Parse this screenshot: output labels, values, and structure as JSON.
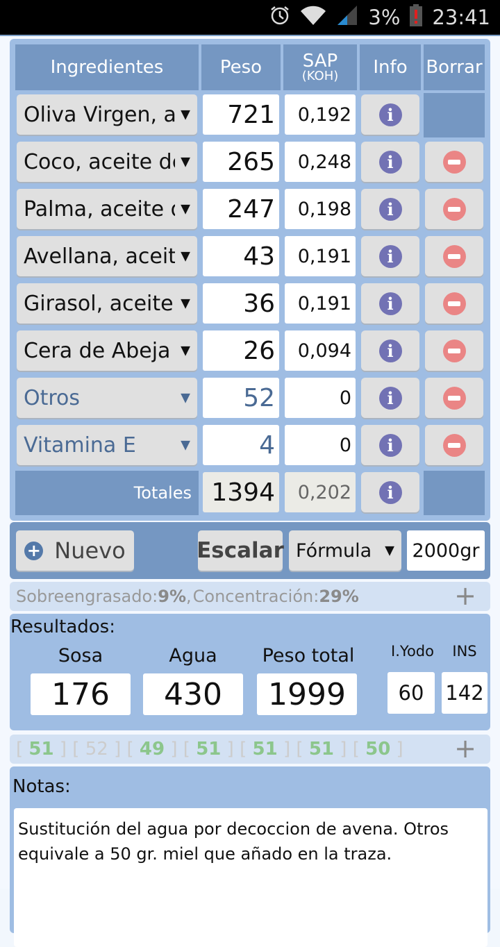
{
  "status_bar": {
    "battery_percent": "3%",
    "time": "23:41",
    "icons": [
      "alarm-icon",
      "wifi-icon",
      "signal-icon",
      "battery-low-icon"
    ]
  },
  "table": {
    "headers": {
      "ingredients": "Ingredientes",
      "weight": "Peso",
      "sap": "SAP",
      "sap_unit": "(KOH)",
      "info": "Info",
      "delete": "Borrar"
    },
    "rows": [
      {
        "ingredient": "Oliva Virgen, aceite de",
        "weight": "721",
        "sap": "0,192",
        "deletable": false,
        "custom": false
      },
      {
        "ingredient": "Coco, aceite de",
        "weight": "265",
        "sap": "0,248",
        "deletable": true,
        "custom": false
      },
      {
        "ingredient": "Palma, aceite de",
        "weight": "247",
        "sap": "0,198",
        "deletable": true,
        "custom": false
      },
      {
        "ingredient": "Avellana, aceite de",
        "weight": "43",
        "sap": "0,191",
        "deletable": true,
        "custom": false
      },
      {
        "ingredient": "Girasol, aceite",
        "weight": "36",
        "sap": "0,191",
        "deletable": true,
        "custom": false
      },
      {
        "ingredient": "Cera de Abeja",
        "weight": "26",
        "sap": "0,094",
        "deletable": true,
        "custom": false
      },
      {
        "ingredient": "Otros",
        "weight": "52",
        "sap": "0",
        "deletable": true,
        "custom": true
      },
      {
        "ingredient": "Vitamina E",
        "weight": "4",
        "sap": "0",
        "deletable": true,
        "custom": true
      }
    ],
    "totals": {
      "label": "Totales",
      "weight": "1394",
      "sap": "0,202"
    }
  },
  "toolbar": {
    "new_label": "Nuevo",
    "scale_label": "Escalar",
    "mode_select": "Fórmula",
    "target_weight": "2000gr"
  },
  "superfat_line": {
    "superfat_label": "Sobreengrasado: ",
    "superfat_value": "9%",
    "separator": ", ",
    "concentration_label": "Concentración: ",
    "concentration_value": "29%",
    "expand": "+"
  },
  "results": {
    "title": "Resultados:",
    "lye_label": "Sosa",
    "lye_value": "176",
    "water_label": "Agua",
    "water_value": "430",
    "total_label": "Peso total",
    "total_value": "1999",
    "iodine_label": "I.Yodo",
    "iodine_value": "60",
    "ins_label": "INS",
    "ins_value": "142"
  },
  "properties_line": {
    "values": [
      {
        "value": "51",
        "active": true
      },
      {
        "value": "52",
        "active": false
      },
      {
        "value": "49",
        "active": true
      },
      {
        "value": "51",
        "active": true
      },
      {
        "value": "51",
        "active": true
      },
      {
        "value": "51",
        "active": true
      },
      {
        "value": "50",
        "active": true
      }
    ],
    "expand": "+"
  },
  "notes": {
    "title": "Notas:",
    "text": "Sustitución del agua por decoccion de avena. Otros equivale a 50 gr. miel que añado en la traza."
  }
}
